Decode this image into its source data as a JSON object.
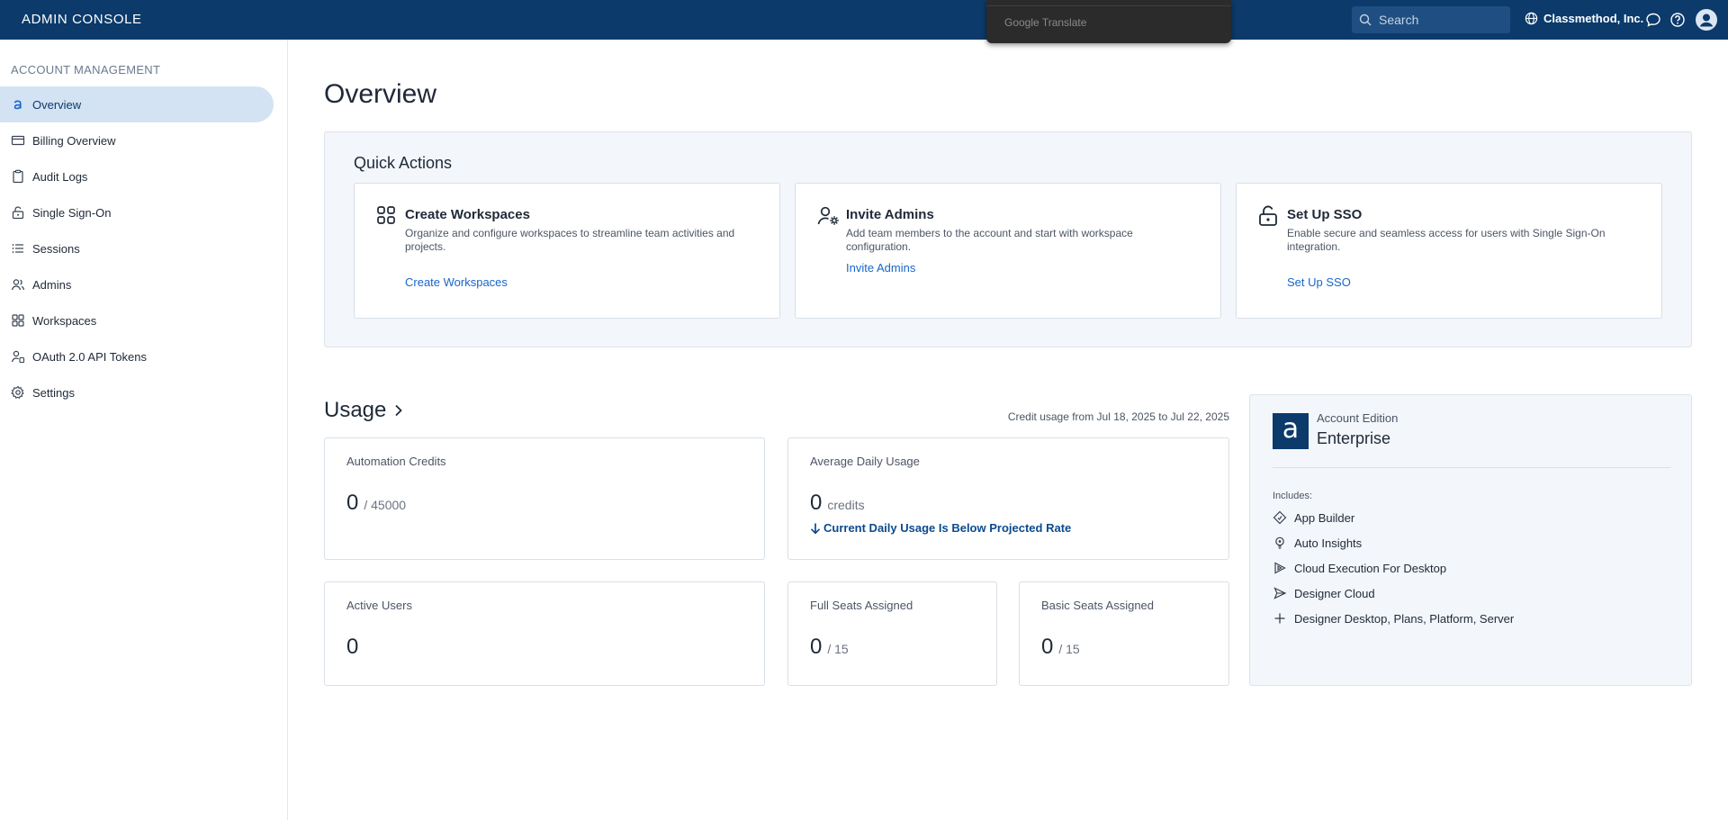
{
  "header": {
    "brand": "ADMIN CONSOLE",
    "translate_popup": "Google Translate",
    "search_placeholder": "Search",
    "org_name": "Classmethod, Inc."
  },
  "sidebar": {
    "heading": "ACCOUNT MANAGEMENT",
    "items": [
      {
        "label": "Overview",
        "icon": "logo-a-icon",
        "active": true
      },
      {
        "label": "Billing Overview",
        "icon": "credit-card-icon"
      },
      {
        "label": "Audit Logs",
        "icon": "clipboard-icon"
      },
      {
        "label": "Single Sign-On",
        "icon": "lock-open-icon"
      },
      {
        "label": "Sessions",
        "icon": "list-icon"
      },
      {
        "label": "Admins",
        "icon": "users-icon"
      },
      {
        "label": "Workspaces",
        "icon": "grid-icon"
      },
      {
        "label": "OAuth 2.0 API Tokens",
        "icon": "user-key-icon"
      },
      {
        "label": "Settings",
        "icon": "gear-icon"
      }
    ]
  },
  "main": {
    "title": "Overview",
    "quick_actions": {
      "title": "Quick Actions",
      "cards": [
        {
          "title": "Create Workspaces",
          "description": "Organize and configure workspaces to streamline team activities and projects.",
          "link": "Create Workspaces",
          "icon": "grid-icon"
        },
        {
          "title": "Invite Admins",
          "description": "Add team members to the account and start with workspace configuration.",
          "link": "Invite Admins",
          "icon": "user-gear-icon"
        },
        {
          "title": "Set Up SSO",
          "description": "Enable secure and seamless access for users with Single Sign-On integration.",
          "link": "Set Up SSO",
          "icon": "lock-open-icon"
        }
      ]
    },
    "usage": {
      "title": "Usage",
      "credit_range": "Credit usage from Jul 18, 2025 to Jul 22, 2025",
      "automation_credits": {
        "label": "Automation Credits",
        "value": "0",
        "total": "/ 45000"
      },
      "average_daily_usage": {
        "label": "Average Daily Usage",
        "value": "0",
        "unit": "credits",
        "projection": "Current Daily Usage Is Below Projected Rate"
      },
      "active_users": {
        "label": "Active Users",
        "value": "0"
      },
      "full_seats": {
        "label": "Full Seats Assigned",
        "value": "0",
        "total": "/ 15"
      },
      "basic_seats": {
        "label": "Basic Seats Assigned",
        "value": "0",
        "total": "/ 15"
      }
    },
    "edition": {
      "logo_letter": "a",
      "label": "Account Edition",
      "name": "Enterprise",
      "includes_label": "Includes:",
      "items": [
        {
          "label": "App Builder",
          "icon": "app-builder-icon"
        },
        {
          "label": "Auto Insights",
          "icon": "lightbulb-icon"
        },
        {
          "label": "Cloud Execution For Desktop",
          "icon": "play-triangle-icon"
        },
        {
          "label": "Designer Cloud",
          "icon": "send-icon"
        },
        {
          "label": "Designer Desktop, Plans, Platform, Server",
          "icon": "plus-icon"
        }
      ]
    }
  },
  "colors": {
    "header_bg": "#0b3a6b",
    "link": "#1a66c9",
    "active_nav_bg": "#d3e3f3",
    "panel_bg": "#f3f6fa"
  }
}
